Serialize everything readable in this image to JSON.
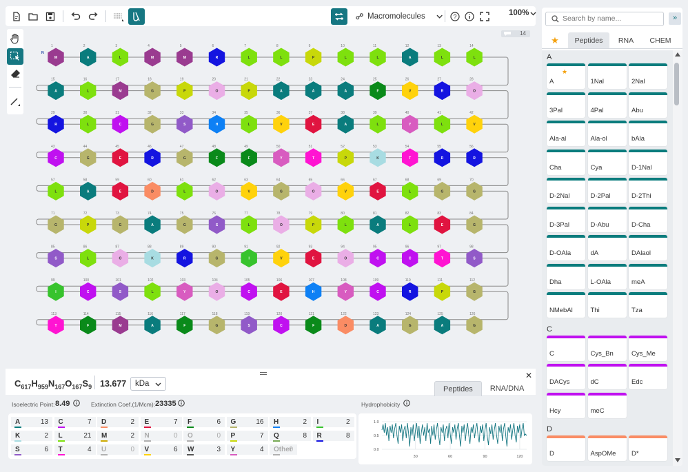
{
  "toolbar": {
    "macromolecules_label": "Macromolecules",
    "zoom": "100%"
  },
  "canvas": {
    "n_terminal": "N",
    "comment_count": "14",
    "sequence": [
      "M",
      "A",
      "L",
      "M",
      "M",
      "R",
      "L",
      "L",
      "P",
      "L",
      "L",
      "A",
      "L",
      "L",
      "A",
      "L",
      "M",
      "G",
      "P",
      "O",
      "P",
      "A",
      "A",
      "A",
      "F",
      "V",
      "R",
      "O",
      "R",
      "L",
      "C",
      "G",
      "S",
      "H",
      "L",
      "V",
      "E",
      "A",
      "L",
      "Y",
      "L",
      "V",
      "C",
      "G",
      "E",
      "R",
      "G",
      "F",
      "F",
      "Y",
      "T",
      "P",
      "K",
      "T",
      "R",
      "R",
      "L",
      "A",
      "E",
      "D",
      "L",
      "O",
      "V",
      "G",
      "O",
      "V",
      "E",
      "L",
      "G",
      "G",
      "G",
      "P",
      "G",
      "A",
      "G",
      "S",
      "L",
      "O",
      "P",
      "L",
      "A",
      "L",
      "E",
      "G",
      "S",
      "L",
      "O",
      "K",
      "R",
      "G",
      "I",
      "V",
      "E",
      "O",
      "C",
      "C",
      "T",
      "S",
      "I",
      "C",
      "S",
      "L",
      "Y",
      "O",
      "C",
      "E",
      "H",
      "Y",
      "C",
      "R",
      "P",
      "G",
      "T",
      "F",
      "M",
      "A",
      "F",
      "G",
      "S",
      "C",
      "F",
      "D",
      "A",
      "G",
      "A",
      "G"
    ],
    "colors": {
      "A": "#0a7c7d",
      "L": "#7ee00e",
      "M": "#9a3b90",
      "G": "#b7b56c",
      "P": "#c8d80a",
      "O": "#eaaee6",
      "F": "#0a8a1a",
      "V": "#ffd20c",
      "R": "#1414e0",
      "C": "#c011f0",
      "S": "#915ac8",
      "H": "#0d80f5",
      "E": "#e01440",
      "Y": "#d85cc0",
      "T": "#ff14d2",
      "K": "#a8dce2",
      "D": "#fa8c64",
      "I": "#37c32d"
    }
  },
  "formula": {
    "parts": [
      {
        "el": "C",
        "n": "617"
      },
      {
        "el": "H",
        "n": "959"
      },
      {
        "el": "N",
        "n": "167"
      },
      {
        "el": "O",
        "n": "167"
      },
      {
        "el": "S",
        "n": "9"
      }
    ],
    "mass": "13.677",
    "unit": "kDa"
  },
  "bottom_tabs": [
    "Peptides",
    "RNA/DNA"
  ],
  "properties": {
    "isoelectric_label": "Isoelectric Point:",
    "isoelectric_value": "8.49",
    "extinction_label": "Extinction Coef.(1/Mcm):",
    "extinction_value": "23335",
    "hydro_label": "Hydrophobicity"
  },
  "aa_counts": [
    {
      "l": "A",
      "c": "13",
      "col": "#0a7c7d"
    },
    {
      "l": "C",
      "c": "7",
      "col": "#c011f0"
    },
    {
      "l": "D",
      "c": "2",
      "col": "#fa8c64"
    },
    {
      "l": "E",
      "c": "7",
      "col": "#e01440"
    },
    {
      "l": "F",
      "c": "6",
      "col": "#0a8a1a"
    },
    {
      "l": "G",
      "c": "16",
      "col": "#b7b56c"
    },
    {
      "l": "H",
      "c": "2",
      "col": "#0d80f5"
    },
    {
      "l": "I",
      "c": "2",
      "col": "#37c32d"
    },
    {
      "l": "K",
      "c": "2",
      "col": "#a8dce2"
    },
    {
      "l": "L",
      "c": "21",
      "col": "#7ee00e"
    },
    {
      "l": "M",
      "c": "2",
      "col": "#ccaa00"
    },
    {
      "l": "N",
      "c": "0",
      "col": "#b0b0b0"
    },
    {
      "l": "O",
      "c": "0",
      "col": "#b0b0b0"
    },
    {
      "l": "P",
      "c": "7",
      "col": "#c8d80a"
    },
    {
      "l": "Q",
      "c": "8",
      "col": "#77aa55"
    },
    {
      "l": "R",
      "c": "8",
      "col": "#1414e0"
    },
    {
      "l": "S",
      "c": "6",
      "col": "#915ac8"
    },
    {
      "l": "T",
      "c": "4",
      "col": "#ff14d2"
    },
    {
      "l": "U",
      "c": "0",
      "col": "#b0b0b0"
    },
    {
      "l": "V",
      "c": "6",
      "col": "#ffd20c"
    },
    {
      "l": "W",
      "c": "3",
      "col": "#555555"
    },
    {
      "l": "Y",
      "c": "4",
      "col": "#d85cc0"
    },
    {
      "l": "Other",
      "c": "0",
      "col": "#b0b0b0"
    }
  ],
  "chart_data": {
    "type": "line",
    "title": "Hydrophobicity",
    "xticks": [
      "30",
      "60",
      "90",
      "120"
    ],
    "yticks": [
      "1.0",
      "0.5",
      "0.0"
    ],
    "ylim": [
      0,
      1
    ],
    "x": [
      1,
      2,
      3,
      4,
      5,
      6,
      7,
      8,
      9,
      10,
      11,
      12,
      13,
      14,
      15,
      16,
      17,
      18,
      19,
      20,
      21,
      22,
      23,
      24,
      25,
      26,
      27,
      28,
      29,
      30,
      31,
      32,
      33,
      34,
      35,
      36,
      37,
      38,
      39,
      40,
      41,
      42,
      43,
      44,
      45,
      46,
      47,
      48,
      49,
      50,
      51,
      52,
      53,
      54,
      55,
      56,
      57,
      58,
      59,
      60,
      61,
      62,
      63,
      64,
      65,
      66,
      67,
      68,
      69,
      70,
      71,
      72,
      73,
      74,
      75,
      76,
      77,
      78,
      79,
      80,
      81,
      82,
      83,
      84,
      85,
      86,
      87,
      88,
      89,
      90,
      91,
      92,
      93,
      94,
      95,
      96,
      97,
      98,
      99,
      100,
      101,
      102,
      103,
      104,
      105,
      106,
      107,
      108,
      109,
      110,
      111,
      112,
      113,
      114,
      115,
      116,
      117,
      118,
      119,
      120,
      121,
      122,
      123,
      124,
      125,
      126
    ],
    "series": [
      {
        "values": [
          0.7,
          0.9,
          0.6,
          0.95,
          0.5,
          0.8,
          0.3,
          0.85,
          0.6,
          0.9,
          0.4,
          0.75,
          0.95,
          0.5,
          0.2,
          0.85,
          0.6,
          0.9,
          0.3,
          0.7,
          0.85,
          0.4,
          0.95,
          0.6,
          0.1,
          0.8,
          0.5,
          0.9,
          0.3,
          0.7,
          0.95,
          0.4,
          0.85,
          0.2,
          0.6,
          0.9,
          0.5,
          0.8,
          0.3,
          0.95,
          0.6,
          0.75,
          0.2,
          0.85,
          0.5,
          0.9,
          0.35,
          0.7,
          0.95,
          0.5,
          0.15,
          0.8,
          0.6,
          0.9,
          0.3,
          0.7,
          0.85,
          0.4,
          0.95,
          0.55,
          0.2,
          0.8,
          0.6,
          0.9,
          0.35,
          0.75,
          0.95,
          0.45,
          0.1,
          0.85,
          0.6,
          0.9,
          0.3,
          0.7,
          0.95,
          0.5,
          0.2,
          0.8,
          0.6,
          0.9,
          0.4,
          0.75,
          0.95,
          0.5,
          0.25,
          0.85,
          0.6,
          0.9,
          0.3,
          0.7,
          0.95,
          0.45,
          0.15,
          0.8,
          0.55,
          0.9,
          0.35,
          0.7,
          0.95,
          0.5,
          0.2,
          0.85,
          0.6,
          0.9,
          0.3,
          0.75,
          0.95,
          0.45,
          0.1,
          0.8,
          0.6,
          0.9,
          0.35,
          0.7,
          0.95,
          0.5,
          0.25,
          0.85,
          0.6,
          0.9,
          0.4,
          0.75,
          0.95,
          0.5,
          0.55,
          0.5
        ]
      }
    ]
  },
  "library": {
    "search_placeholder": "Search by name...",
    "tabs": [
      "Peptides",
      "RNA",
      "CHEM"
    ],
    "sections": [
      {
        "letter": "A",
        "color": "#0a7c7d",
        "items": [
          "A",
          "1Nal",
          "2Nal",
          "3Pal",
          "4Pal",
          "Abu",
          "Ala-al",
          "Ala-ol",
          "bAla",
          "Cha",
          "Cya",
          "D-1Nal",
          "D-2Nal",
          "D-2Pal",
          "D-2Thi",
          "D-3Pal",
          "D-Abu",
          "D-Cha",
          "D-OAla",
          "dA",
          "DAlaol",
          "Dha",
          "L-OAla",
          "meA",
          "NMebAl",
          "Thi",
          "Tza"
        ]
      },
      {
        "letter": "C",
        "color": "#c011f0",
        "items": [
          "C",
          "Cys_Bn",
          "Cys_Me",
          "DACys",
          "dC",
          "Edc",
          "Hcy",
          "meC"
        ]
      },
      {
        "letter": "D",
        "color": "#fa8c64",
        "items": [
          "D",
          "AspOMe",
          "D*"
        ]
      }
    ]
  }
}
